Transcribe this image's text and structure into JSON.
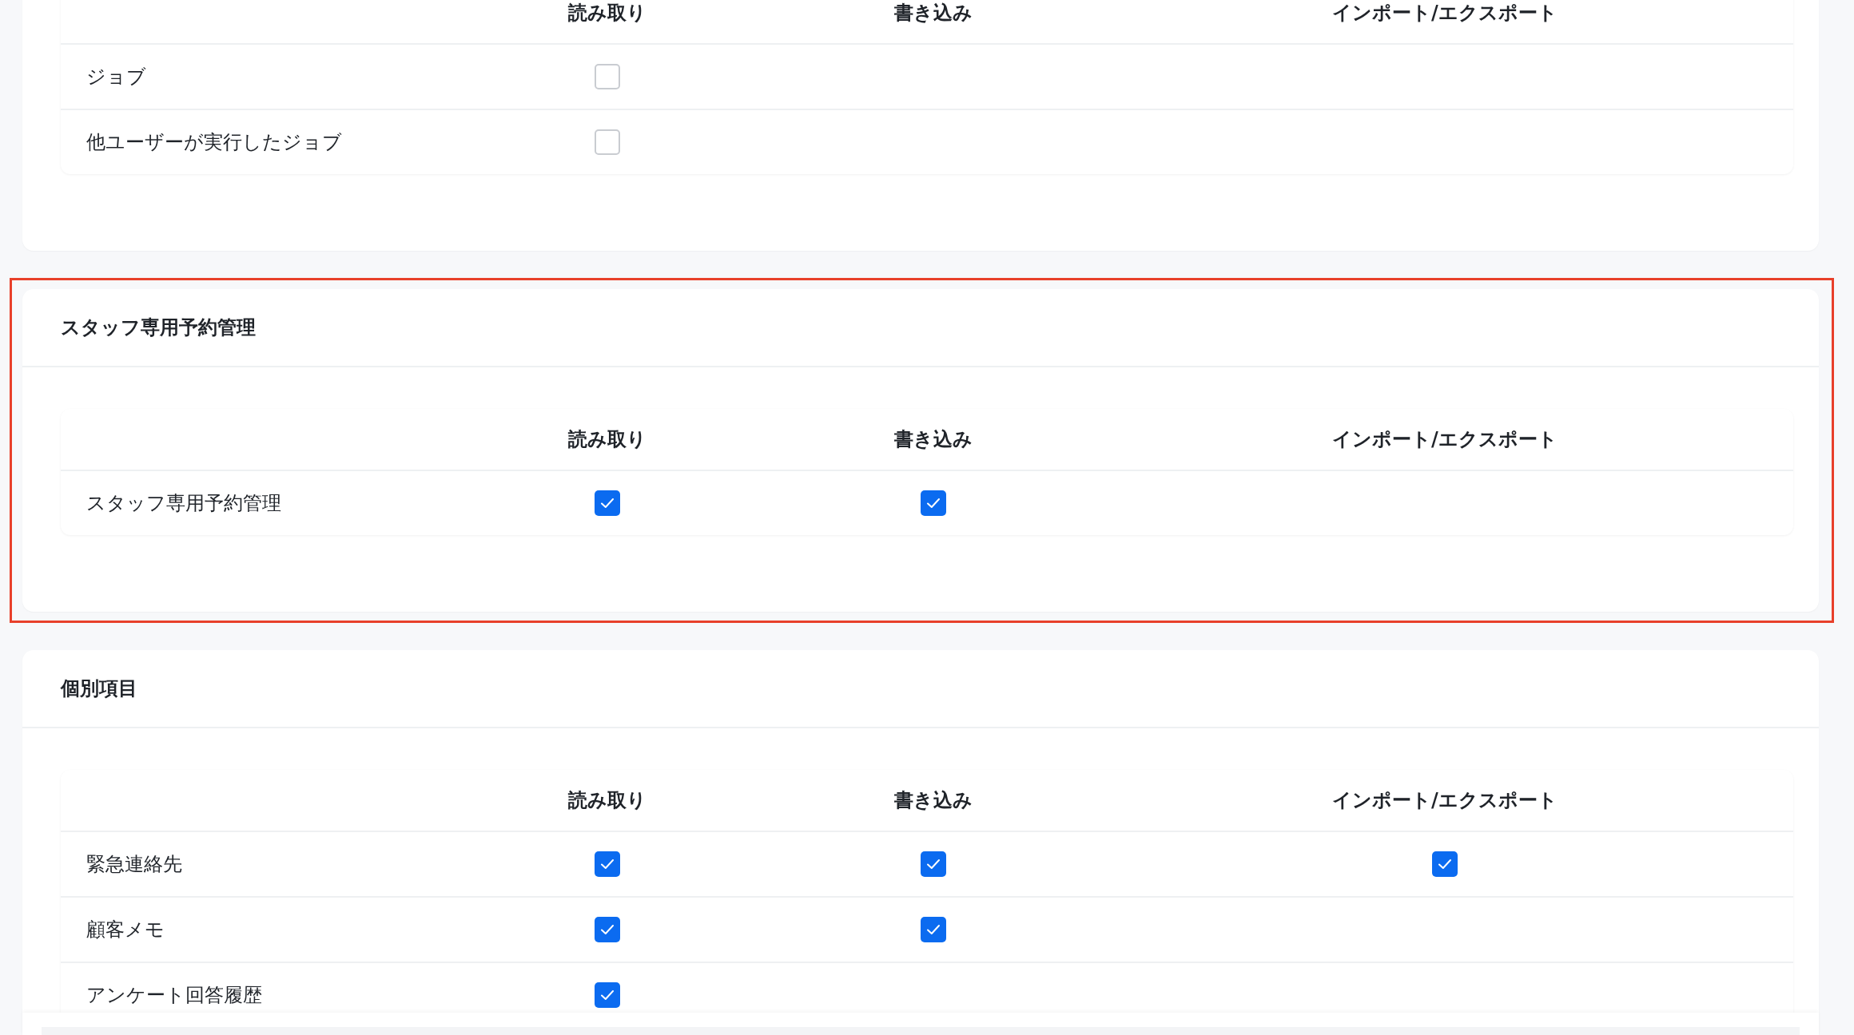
{
  "sections": [
    {
      "highlighted": false,
      "columns": [
        "読み取り",
        "書き込み",
        "インポート/エクスポート"
      ],
      "rows": [
        {
          "label": "ジョブ",
          "permissions": [
            {
              "checked": false
            }
          ]
        },
        {
          "label": "他ユーザーが実行したジョブ",
          "permissions": [
            {
              "checked": false
            }
          ]
        }
      ]
    },
    {
      "title": "スタッフ専用予約管理",
      "highlighted": true,
      "columns": [
        "読み取り",
        "書き込み",
        "インポート/エクスポート"
      ],
      "rows": [
        {
          "label": "スタッフ専用予約管理",
          "permissions": [
            {
              "checked": true
            },
            {
              "checked": true
            }
          ]
        }
      ]
    },
    {
      "title": "個別項目",
      "highlighted": false,
      "columns": [
        "読み取り",
        "書き込み",
        "インポート/エクスポート"
      ],
      "rows": [
        {
          "label": "緊急連絡先",
          "permissions": [
            {
              "checked": true
            },
            {
              "checked": true
            },
            {
              "checked": true
            }
          ]
        },
        {
          "label": "顧客メモ",
          "permissions": [
            {
              "checked": true
            },
            {
              "checked": true
            }
          ]
        },
        {
          "label": "アンケート回答履歴",
          "permissions": [
            {
              "checked": true
            }
          ]
        }
      ]
    }
  ]
}
